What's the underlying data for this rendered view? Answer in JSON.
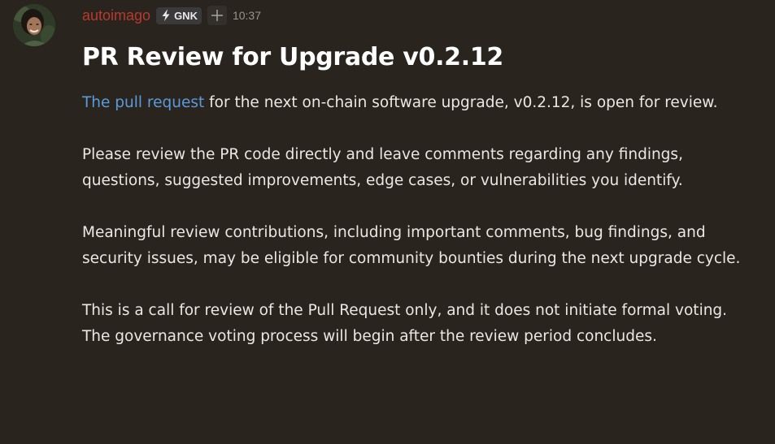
{
  "message": {
    "author": {
      "username": "autoimago",
      "username_color": "#b83a2c",
      "avatar_icon": "user-avatar"
    },
    "badge": {
      "icon": "lightning-bolt-icon",
      "label": "GNK"
    },
    "extra_icon": "plus-icon",
    "timestamp": "10:37",
    "title": "PR Review for Upgrade v0.2.12",
    "paragraphs": [
      {
        "link_text": "The pull request",
        "text": " for the next on-chain software upgrade, v0.2.12, is open for review."
      },
      {
        "text": "Please review the PR code directly and leave comments regarding any findings, questions, suggested improvements, edge cases, or vulnerabilities you identify."
      },
      {
        "text": "Meaningful review contributions, including important comments, bug findings, and security issues, may be eligible for community bounties during the next upgrade cycle."
      },
      {
        "text": "This is a call for review of the Pull Request only, and it does not initiate formal voting. The governance voting process will begin after the review period concludes."
      }
    ]
  },
  "colors": {
    "background": "#2a241f",
    "link": "#5b9bd9",
    "text": "#ebe7e3",
    "title": "#ffffff"
  }
}
